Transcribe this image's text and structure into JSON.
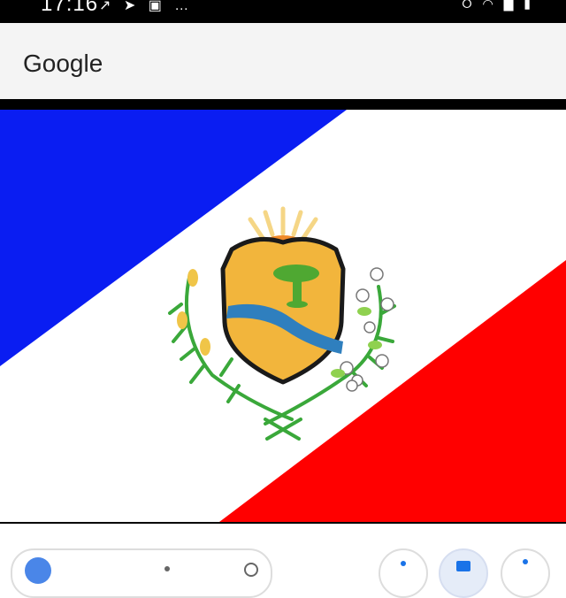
{
  "status_bar": {
    "time": "17:16",
    "left_icons": [
      "trend-icon",
      "send-icon",
      "gallery-icon",
      "more-dots-icon"
    ],
    "right_icons": [
      "vibrate-icon",
      "wifi-icon",
      "signal-icon",
      "battery-icon"
    ]
  },
  "header": {
    "title": "Google"
  },
  "image": {
    "subject": "flag",
    "colors": {
      "blue": "#0a1df2",
      "white": "#ffffff",
      "red": "#ff0000",
      "shield": "#f2b53c",
      "river": "#2f7fbe",
      "tree": "#4fa832",
      "sun": "#f08a2a",
      "leaf": "#3aa83a"
    }
  },
  "bottom_bar": {
    "icons": [
      "google-lens-icon",
      "share-icon",
      "save-icon",
      "more-icon"
    ]
  }
}
